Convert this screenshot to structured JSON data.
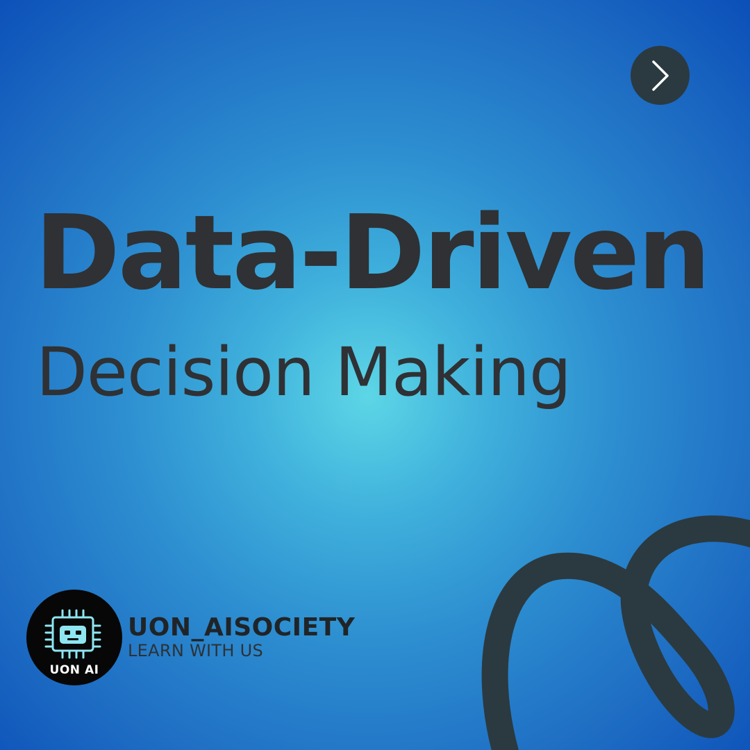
{
  "slide": {
    "title": "Data-Driven",
    "subtitle": "Decision Making"
  },
  "next_button": {
    "icon": "chevron-right-icon"
  },
  "brand": {
    "logo_text": "UON AI",
    "name": "UON_AISOCIETY",
    "tagline": "LEARN WITH US"
  },
  "colors": {
    "background_center": "#5dd6e6",
    "background_edge": "#0b4fb8",
    "text": "#2f3134",
    "swirl": "#2b3a40",
    "logo_accent": "#8ee6f0"
  }
}
